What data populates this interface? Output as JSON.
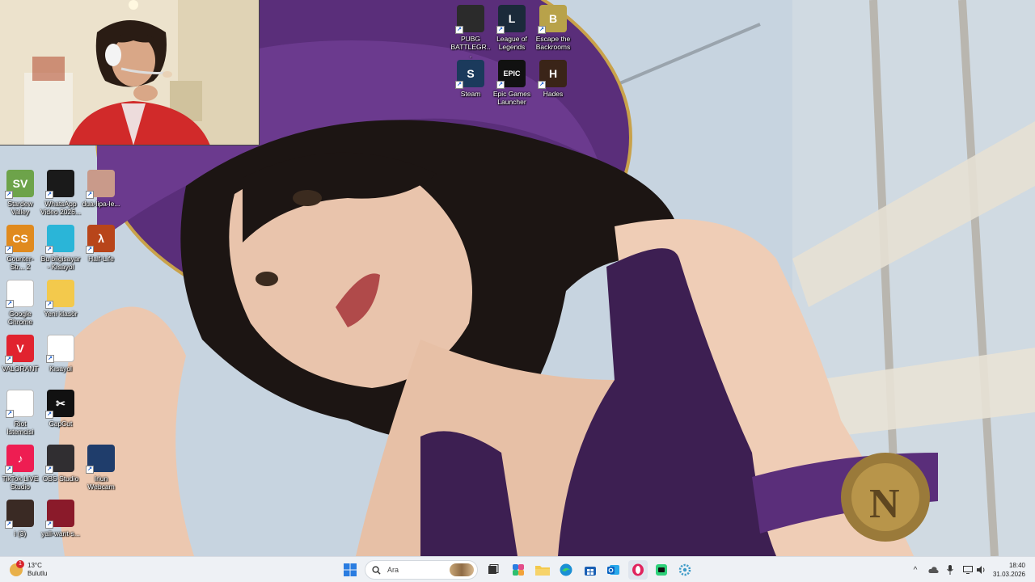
{
  "desktop": {
    "icons": [
      {
        "name": "icon-pubg",
        "label": "PUBG BATTLEGR...",
        "glyph": "",
        "color": "#2b2b2b"
      },
      {
        "name": "icon-league-of-legends",
        "label": "League of Legends",
        "glyph": "L",
        "color": "#1b2a3a"
      },
      {
        "name": "icon-escape-the-backrooms",
        "label": "Escape the Backrooms",
        "glyph": "B",
        "color": "#b8a24a"
      },
      {
        "name": "icon-steam",
        "label": "Steam",
        "glyph": "S",
        "color": "#1b3a5c"
      },
      {
        "name": "icon-epic-games",
        "label": "Epic Games Launcher",
        "glyph": "EPIC",
        "color": "#111111"
      },
      {
        "name": "icon-hades",
        "label": "Hades",
        "glyph": "H",
        "color": "#3a2418"
      },
      {
        "name": "icon-stardew-valley",
        "label": "Stardew Valley",
        "glyph": "SV",
        "color": "#6da34a"
      },
      {
        "name": "icon-whatsapp-video",
        "label": "WhatsApp Video 2026...",
        "glyph": "",
        "color": "#1a1a1a"
      },
      {
        "name": "icon-dua-lipa",
        "label": "dua-lipa-le...",
        "glyph": "",
        "color": "#c99a8a"
      },
      {
        "name": "icon-counter-strike",
        "label": "Counter-Str... 2",
        "glyph": "CS",
        "color": "#e08a1e"
      },
      {
        "name": "icon-this-pc",
        "label": "Bu bilgisayar - Kısayol",
        "glyph": "",
        "color": "#2ab5d8"
      },
      {
        "name": "icon-half-life",
        "label": "Half-Life",
        "glyph": "λ",
        "color": "#b8451a"
      },
      {
        "name": "icon-google-chrome",
        "label": "Google Chrome",
        "glyph": "",
        "color": "#ffffff"
      },
      {
        "name": "icon-new-folder",
        "label": "Yeni klasör",
        "glyph": "",
        "color": "#f3c94c"
      },
      {
        "name": "icon-valorant",
        "label": "VALORANT",
        "glyph": "V",
        "color": "#e1232f"
      },
      {
        "name": "icon-shortcut",
        "label": "Kısayol",
        "glyph": "",
        "color": "#ffffff"
      },
      {
        "name": "icon-riot-client",
        "label": "Riot İstemcisi",
        "glyph": "",
        "color": "#ffffff"
      },
      {
        "name": "icon-capcut",
        "label": "CapCut",
        "glyph": "✂",
        "color": "#111111"
      },
      {
        "name": "icon-tiktok-live-studio",
        "label": "TikTok LIVE Studio",
        "glyph": "♪",
        "color": "#ee1d52"
      },
      {
        "name": "icon-obs-studio",
        "label": "OBS Studio",
        "glyph": "",
        "color": "#302e31"
      },
      {
        "name": "icon-iriun-webcam",
        "label": "Iriun Webcam",
        "glyph": "",
        "color": "#1f3d6b"
      },
      {
        "name": "icon-image-i3",
        "label": "i (3)",
        "glyph": "",
        "color": "#3a2a24"
      },
      {
        "name": "icon-yall-want",
        "label": "yall-want-s...",
        "glyph": "",
        "color": "#8a1a2a"
      }
    ]
  },
  "taskbar": {
    "weather": {
      "temp": "13°C",
      "condition": "Bulutlu",
      "badge": "1"
    },
    "search": {
      "placeholder": "Ara"
    },
    "clock": {
      "time": "18:40",
      "date": "31.03.2026"
    },
    "apps": [
      {
        "name": "start-button",
        "icon": "windows-start-icon"
      },
      {
        "name": "task-view-button",
        "icon": "task-view-icon"
      },
      {
        "name": "copilot-button",
        "icon": "copilot-icon"
      },
      {
        "name": "file-explorer-button",
        "icon": "folder-icon"
      },
      {
        "name": "edge-button",
        "icon": "edge-icon"
      },
      {
        "name": "microsoft-store-button",
        "icon": "store-icon"
      },
      {
        "name": "outlook-button",
        "icon": "outlook-icon"
      },
      {
        "name": "opera-button",
        "icon": "opera-icon"
      },
      {
        "name": "app-green-button",
        "icon": "app-icon"
      },
      {
        "name": "settings-button",
        "icon": "gear-icon"
      }
    ]
  }
}
